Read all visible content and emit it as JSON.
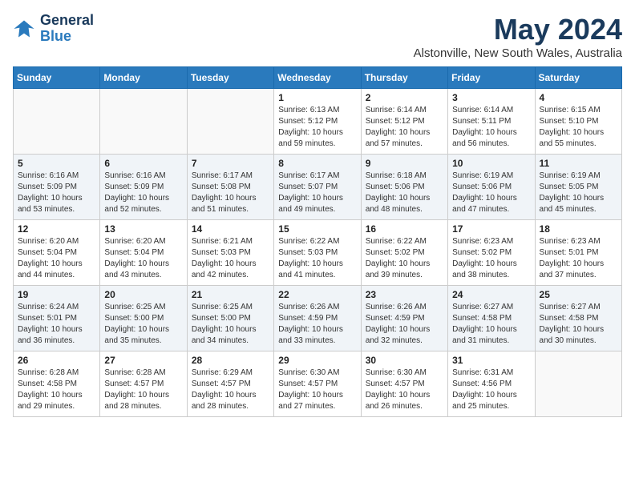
{
  "header": {
    "logo_line1": "General",
    "logo_line2": "Blue",
    "month": "May 2024",
    "location": "Alstonville, New South Wales, Australia"
  },
  "weekdays": [
    "Sunday",
    "Monday",
    "Tuesday",
    "Wednesday",
    "Thursday",
    "Friday",
    "Saturday"
  ],
  "weeks": [
    [
      {
        "day": "",
        "info": ""
      },
      {
        "day": "",
        "info": ""
      },
      {
        "day": "",
        "info": ""
      },
      {
        "day": "1",
        "info": "Sunrise: 6:13 AM\nSunset: 5:12 PM\nDaylight: 10 hours\nand 59 minutes."
      },
      {
        "day": "2",
        "info": "Sunrise: 6:14 AM\nSunset: 5:12 PM\nDaylight: 10 hours\nand 57 minutes."
      },
      {
        "day": "3",
        "info": "Sunrise: 6:14 AM\nSunset: 5:11 PM\nDaylight: 10 hours\nand 56 minutes."
      },
      {
        "day": "4",
        "info": "Sunrise: 6:15 AM\nSunset: 5:10 PM\nDaylight: 10 hours\nand 55 minutes."
      }
    ],
    [
      {
        "day": "5",
        "info": "Sunrise: 6:16 AM\nSunset: 5:09 PM\nDaylight: 10 hours\nand 53 minutes."
      },
      {
        "day": "6",
        "info": "Sunrise: 6:16 AM\nSunset: 5:09 PM\nDaylight: 10 hours\nand 52 minutes."
      },
      {
        "day": "7",
        "info": "Sunrise: 6:17 AM\nSunset: 5:08 PM\nDaylight: 10 hours\nand 51 minutes."
      },
      {
        "day": "8",
        "info": "Sunrise: 6:17 AM\nSunset: 5:07 PM\nDaylight: 10 hours\nand 49 minutes."
      },
      {
        "day": "9",
        "info": "Sunrise: 6:18 AM\nSunset: 5:06 PM\nDaylight: 10 hours\nand 48 minutes."
      },
      {
        "day": "10",
        "info": "Sunrise: 6:19 AM\nSunset: 5:06 PM\nDaylight: 10 hours\nand 47 minutes."
      },
      {
        "day": "11",
        "info": "Sunrise: 6:19 AM\nSunset: 5:05 PM\nDaylight: 10 hours\nand 45 minutes."
      }
    ],
    [
      {
        "day": "12",
        "info": "Sunrise: 6:20 AM\nSunset: 5:04 PM\nDaylight: 10 hours\nand 44 minutes."
      },
      {
        "day": "13",
        "info": "Sunrise: 6:20 AM\nSunset: 5:04 PM\nDaylight: 10 hours\nand 43 minutes."
      },
      {
        "day": "14",
        "info": "Sunrise: 6:21 AM\nSunset: 5:03 PM\nDaylight: 10 hours\nand 42 minutes."
      },
      {
        "day": "15",
        "info": "Sunrise: 6:22 AM\nSunset: 5:03 PM\nDaylight: 10 hours\nand 41 minutes."
      },
      {
        "day": "16",
        "info": "Sunrise: 6:22 AM\nSunset: 5:02 PM\nDaylight: 10 hours\nand 39 minutes."
      },
      {
        "day": "17",
        "info": "Sunrise: 6:23 AM\nSunset: 5:02 PM\nDaylight: 10 hours\nand 38 minutes."
      },
      {
        "day": "18",
        "info": "Sunrise: 6:23 AM\nSunset: 5:01 PM\nDaylight: 10 hours\nand 37 minutes."
      }
    ],
    [
      {
        "day": "19",
        "info": "Sunrise: 6:24 AM\nSunset: 5:01 PM\nDaylight: 10 hours\nand 36 minutes."
      },
      {
        "day": "20",
        "info": "Sunrise: 6:25 AM\nSunset: 5:00 PM\nDaylight: 10 hours\nand 35 minutes."
      },
      {
        "day": "21",
        "info": "Sunrise: 6:25 AM\nSunset: 5:00 PM\nDaylight: 10 hours\nand 34 minutes."
      },
      {
        "day": "22",
        "info": "Sunrise: 6:26 AM\nSunset: 4:59 PM\nDaylight: 10 hours\nand 33 minutes."
      },
      {
        "day": "23",
        "info": "Sunrise: 6:26 AM\nSunset: 4:59 PM\nDaylight: 10 hours\nand 32 minutes."
      },
      {
        "day": "24",
        "info": "Sunrise: 6:27 AM\nSunset: 4:58 PM\nDaylight: 10 hours\nand 31 minutes."
      },
      {
        "day": "25",
        "info": "Sunrise: 6:27 AM\nSunset: 4:58 PM\nDaylight: 10 hours\nand 30 minutes."
      }
    ],
    [
      {
        "day": "26",
        "info": "Sunrise: 6:28 AM\nSunset: 4:58 PM\nDaylight: 10 hours\nand 29 minutes."
      },
      {
        "day": "27",
        "info": "Sunrise: 6:28 AM\nSunset: 4:57 PM\nDaylight: 10 hours\nand 28 minutes."
      },
      {
        "day": "28",
        "info": "Sunrise: 6:29 AM\nSunset: 4:57 PM\nDaylight: 10 hours\nand 28 minutes."
      },
      {
        "day": "29",
        "info": "Sunrise: 6:30 AM\nSunset: 4:57 PM\nDaylight: 10 hours\nand 27 minutes."
      },
      {
        "day": "30",
        "info": "Sunrise: 6:30 AM\nSunset: 4:57 PM\nDaylight: 10 hours\nand 26 minutes."
      },
      {
        "day": "31",
        "info": "Sunrise: 6:31 AM\nSunset: 4:56 PM\nDaylight: 10 hours\nand 25 minutes."
      },
      {
        "day": "",
        "info": ""
      }
    ]
  ]
}
